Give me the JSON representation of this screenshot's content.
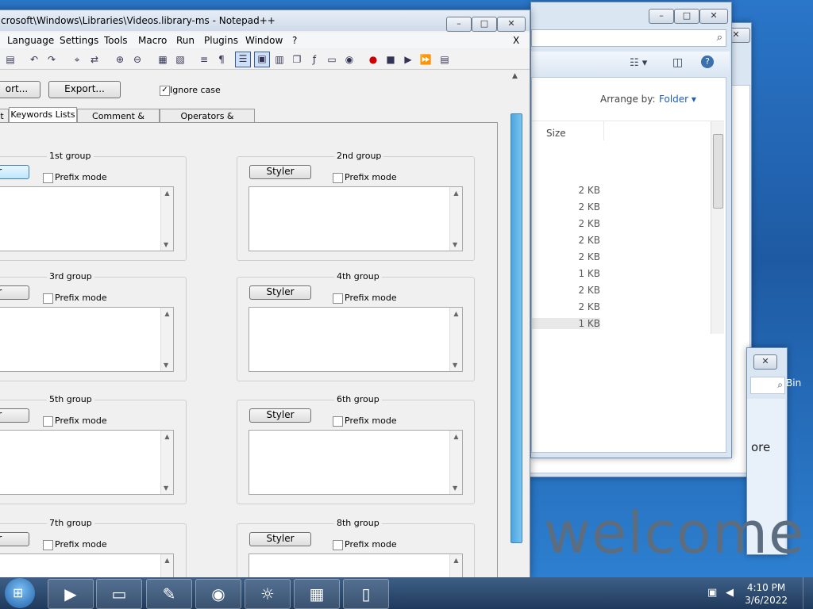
{
  "notepad": {
    "title": "crosoft\\Windows\\Libraries\\Videos.library-ms - Notepad++",
    "menu": [
      "Language",
      "Settings",
      "Tools",
      "Macro",
      "Run",
      "Plugins",
      "Window",
      "?"
    ],
    "menu_close": "X",
    "import_label": "ort...",
    "export_label": "Export...",
    "ignore_case_label": "Ignore case",
    "tabs": [
      "lt",
      "Keywords Lists",
      "Comment & Number",
      "Operators & Delimiters"
    ],
    "groups": [
      {
        "label": "1st group",
        "styler": "er",
        "prefix": "Prefix mode"
      },
      {
        "label": "2nd group",
        "styler": "Styler",
        "prefix": "Prefix mode"
      },
      {
        "label": "3rd group",
        "styler": "er",
        "prefix": "Prefix mode"
      },
      {
        "label": "4th group",
        "styler": "Styler",
        "prefix": "Prefix mode"
      },
      {
        "label": "5th group",
        "styler": "er",
        "prefix": "Prefix mode"
      },
      {
        "label": "6th group",
        "styler": "Styler",
        "prefix": "Prefix mode"
      },
      {
        "label": "7th group",
        "styler": "er",
        "prefix": "Prefix mode"
      },
      {
        "label": "8th group",
        "styler": "Styler",
        "prefix": "Prefix mode"
      }
    ]
  },
  "explorer": {
    "arrange_label": "Arrange by:",
    "arrange_value": "Folder",
    "size_header": "Size",
    "sizes": [
      "2 KB",
      "2 KB",
      "2 KB",
      "2 KB",
      "2 KB",
      "1 KB",
      "2 KB",
      "2 KB",
      "1 KB"
    ]
  },
  "desktop": {
    "bin_text": "Bin",
    "more_text": "ore",
    "welcome_text": "welcome"
  },
  "taskbar": {
    "time": "4:10 PM",
    "date": "3/6/2022"
  }
}
